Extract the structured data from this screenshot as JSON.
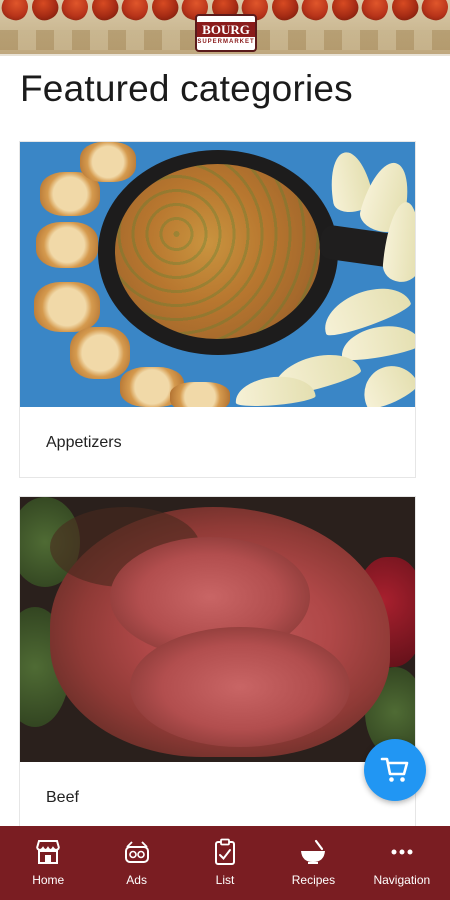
{
  "header": {
    "logo_text": "BOURG",
    "logo_subtext": "SUPERMARKET"
  },
  "page": {
    "title": "Featured categories"
  },
  "categories": [
    {
      "label": "Appetizers"
    },
    {
      "label": "Beef"
    }
  ],
  "fab": {
    "icon": "cart-icon",
    "color": "#2196f3"
  },
  "bottom_nav": {
    "color": "#7a1d22",
    "items": [
      {
        "label": "Home",
        "icon": "store-icon"
      },
      {
        "label": "Ads",
        "icon": "ads-icon"
      },
      {
        "label": "List",
        "icon": "clipboard-icon"
      },
      {
        "label": "Recipes",
        "icon": "mixing-bowl-icon"
      },
      {
        "label": "Navigation",
        "icon": "more-dots-icon"
      }
    ]
  }
}
